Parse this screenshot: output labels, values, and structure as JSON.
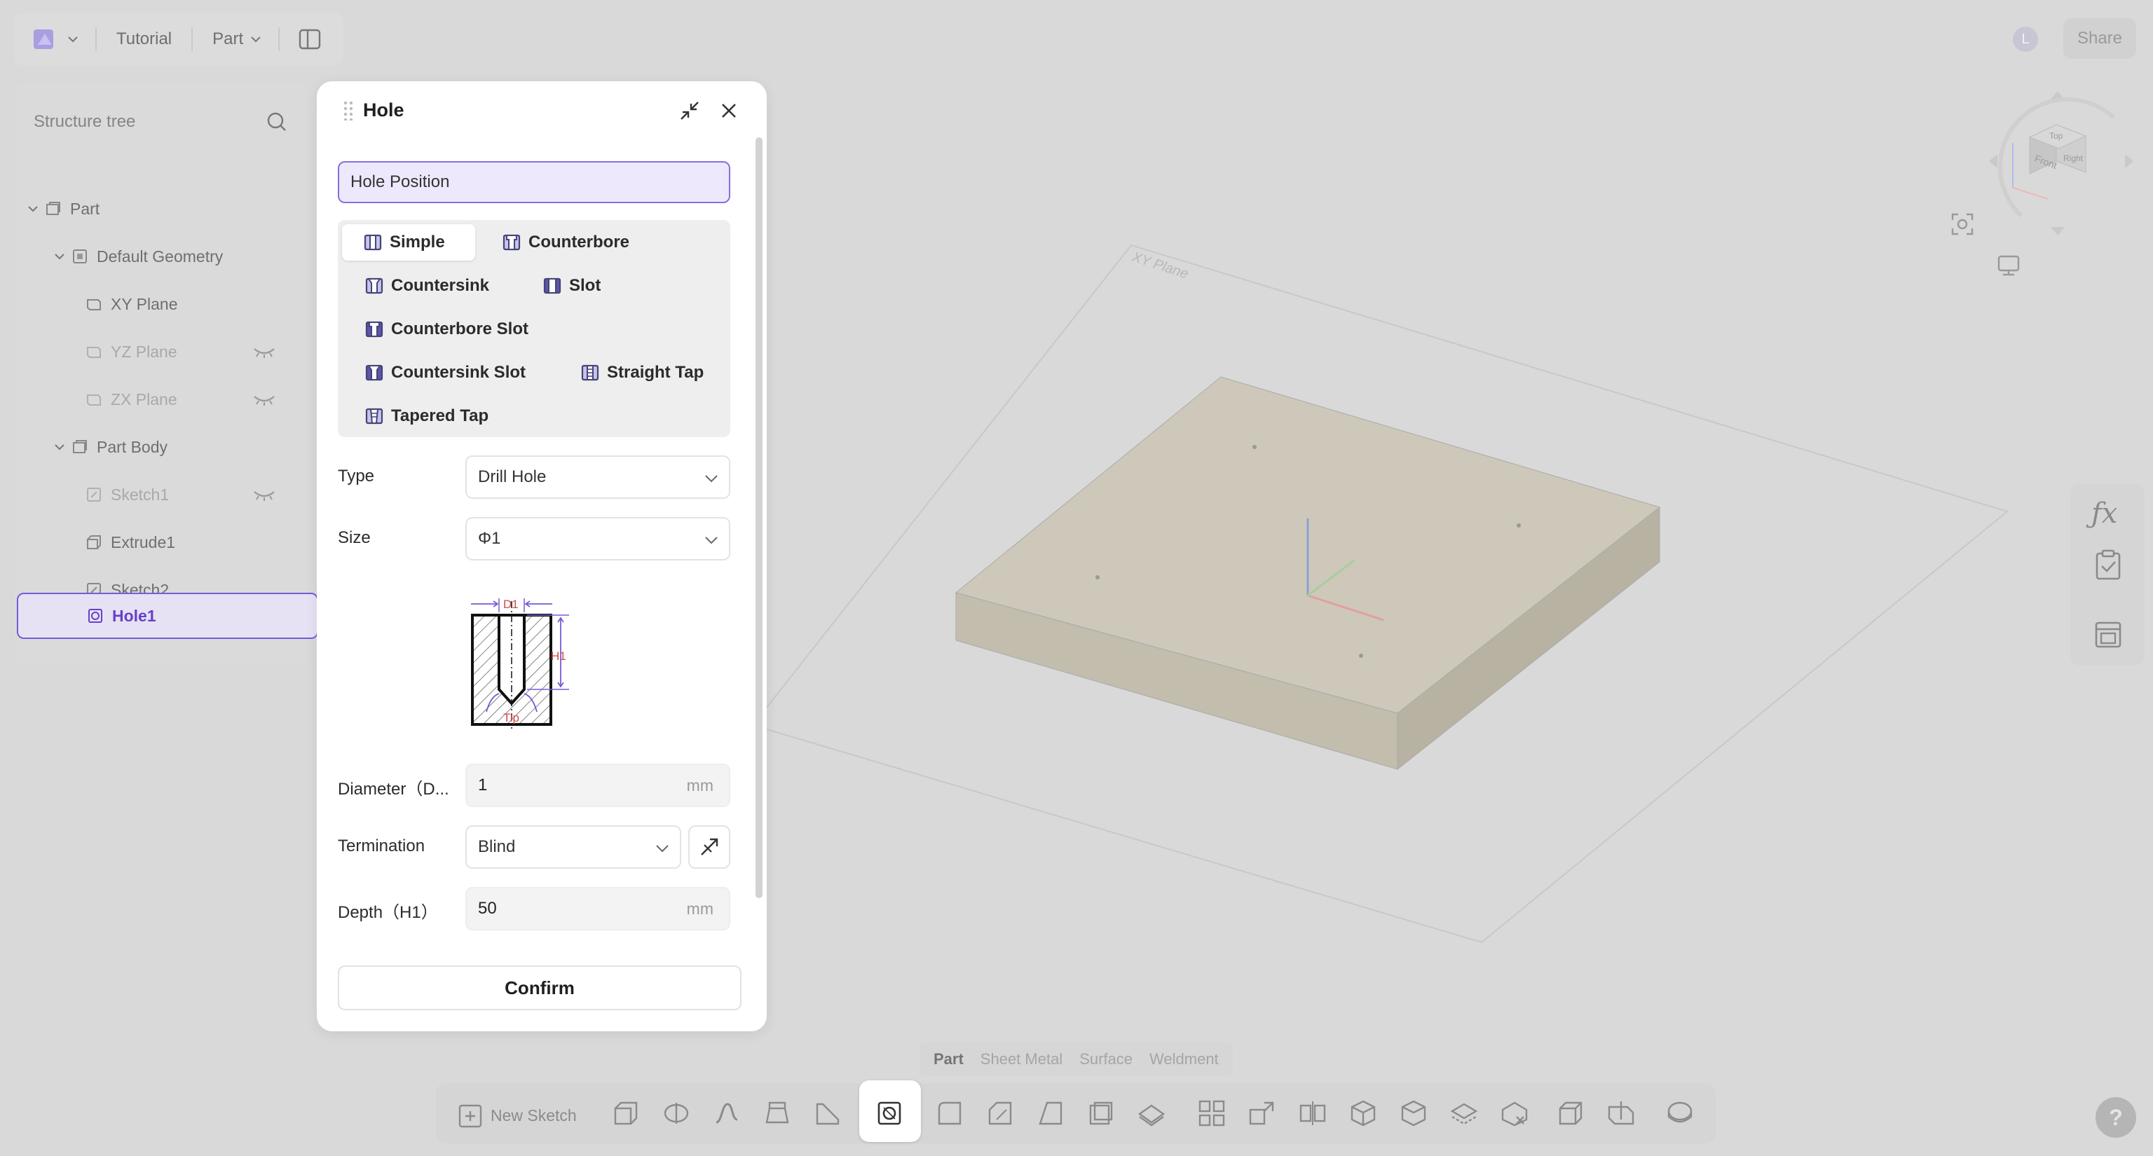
{
  "topbar": {
    "doc_name": "Tutorial",
    "mode": "Part",
    "share": "Share",
    "user_initial": "L"
  },
  "tree": {
    "search_placeholder": "Structure tree",
    "items": [
      {
        "label": "Part",
        "level": 0,
        "dim": false,
        "hidden": false
      },
      {
        "label": "Default Geometry",
        "level": 1,
        "dim": false,
        "hidden": false
      },
      {
        "label": "XY Plane",
        "level": 2,
        "dim": false,
        "hidden": false
      },
      {
        "label": "YZ Plane",
        "level": 2,
        "dim": true,
        "hidden": true
      },
      {
        "label": "ZX Plane",
        "level": 2,
        "dim": true,
        "hidden": true
      },
      {
        "label": "Part Body",
        "level": 1,
        "dim": false,
        "hidden": false
      },
      {
        "label": "Sketch1",
        "level": 2,
        "dim": true,
        "hidden": true
      },
      {
        "label": "Extrude1",
        "level": 2,
        "dim": false,
        "hidden": false
      },
      {
        "label": "Sketch2",
        "level": 2,
        "dim": false,
        "hidden": false
      },
      {
        "label": "Hole1",
        "level": 2,
        "dim": false,
        "hidden": false,
        "selected": true
      }
    ]
  },
  "dialog": {
    "title": "Hole",
    "hole_position": "Hole Position",
    "hole_types": [
      "Simple",
      "Counterbore",
      "Countersink",
      "Slot",
      "Counterbore Slot",
      "Countersink Slot",
      "Straight Tap",
      "Tapered Tap"
    ],
    "selected_type": "Simple",
    "type_label": "Type",
    "type_value": "Drill Hole",
    "size_label": "Size",
    "size_value": "Φ1",
    "diagram": {
      "d1": "D1",
      "h1": "H1",
      "tip": "Tip"
    },
    "diameter_label": "Diameter（D...",
    "diameter_value": "1",
    "diameter_unit": "mm",
    "termination_label": "Termination",
    "termination_value": "Blind",
    "depth_label": "Depth（H1）",
    "depth_value": "50",
    "depth_unit": "mm",
    "confirm": "Confirm"
  },
  "viewport": {
    "plane_label": "XY Plane",
    "cube_faces": [
      "Top",
      "Front",
      "Right"
    ]
  },
  "bottom_tabs": [
    "Part",
    "Sheet Metal",
    "Surface",
    "Weldment"
  ],
  "active_tab": "Part",
  "toolbar": {
    "new_sketch": "New Sketch"
  },
  "colors": {
    "accent": "#7a5ad6",
    "accent_bg": "#ede8fb",
    "body_face": "#cfcabb"
  }
}
